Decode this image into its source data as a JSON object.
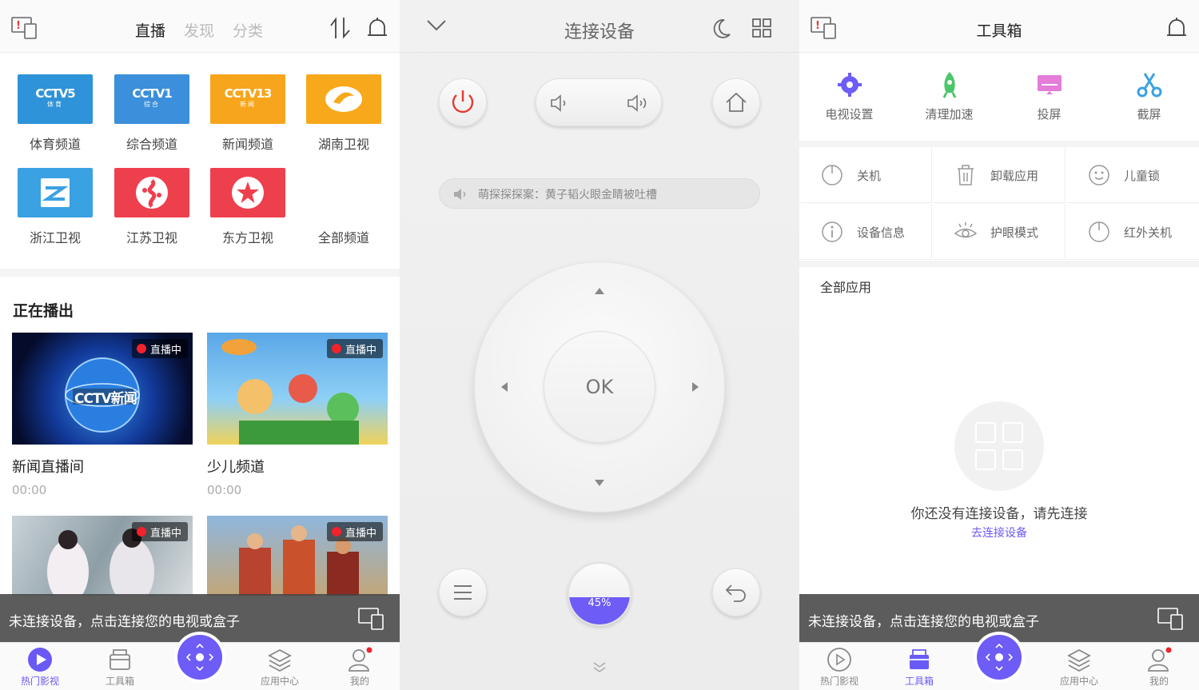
{
  "live": {
    "tabs": [
      "直播",
      "发现",
      "分类"
    ],
    "channels": [
      "体育频道",
      "综合频道",
      "新闻频道",
      "湖南卫视",
      "浙江卫视",
      "江苏卫视",
      "东方卫视",
      "全部频道"
    ],
    "cctv_logos": [
      {
        "text": "CCTV5",
        "sub": "体育",
        "color": "#2e93d8"
      },
      {
        "text": "CCTV1",
        "sub": "综合",
        "color": "#3b8fdb"
      },
      {
        "text": "CCTV13",
        "sub": "新闻",
        "color": "#f7a51c"
      }
    ],
    "section_title": "正在播出",
    "cards": [
      {
        "title": "新闻直播间",
        "time": "00:00",
        "badge": "直播中"
      },
      {
        "title": "少儿频道",
        "time": "00:00",
        "badge": "直播中"
      },
      {
        "title": "",
        "time": "",
        "badge": "直播中"
      },
      {
        "title": "",
        "time": "",
        "badge": "直播中"
      }
    ],
    "thumb_logo": "CCTV新闻"
  },
  "remote": {
    "title": "连接设备",
    "marquee": "萌探探探案：黄子韬火眼金睛被吐槽",
    "ok_label": "OK",
    "volume_percent": "45%",
    "volume_level": 0.45
  },
  "toolbox": {
    "title": "工具箱",
    "tools": [
      "电视设置",
      "清理加速",
      "投屏",
      "截屏"
    ],
    "grid": [
      "关机",
      "卸载应用",
      "儿童锁",
      "设备信息",
      "护眼模式",
      "红外关机"
    ],
    "all_apps": "全部应用",
    "empty_text": "你还没有连接设备，请先连接",
    "connect_link": "去连接设备"
  },
  "banner": {
    "text": "未连接设备，点击连接您的电视或盒子"
  },
  "nav": [
    "热门影视",
    "工具箱",
    "应用中心",
    "我的"
  ],
  "colors": {
    "accent": "#6a5af5",
    "live_red": "#f0222b",
    "power_red": "#e53935"
  }
}
